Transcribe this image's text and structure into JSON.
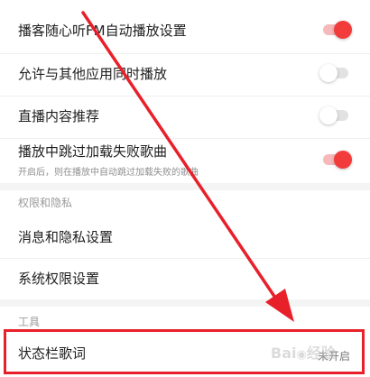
{
  "playback": {
    "items": [
      {
        "label": "播客随心听FM自动播放设置",
        "state": "on"
      },
      {
        "label": "允许与其他应用同时播放",
        "state": "off"
      },
      {
        "label": "直播内容推荐",
        "state": "off"
      },
      {
        "label": "播放中跳过加载失败歌曲",
        "sub": "开启后，则在播放中自动跳过加载失败的歌曲",
        "state": "on"
      }
    ]
  },
  "privacy": {
    "title": "权限和隐私",
    "items": [
      {
        "label": "消息和隐私设置"
      },
      {
        "label": "系统权限设置"
      }
    ]
  },
  "tools": {
    "title": "工具",
    "items": [
      {
        "label": "状态栏歌词",
        "value": "未开启"
      }
    ]
  },
  "colors": {
    "accent_red": "#f23c3c",
    "highlight_border": "#e8202a",
    "annotation_arrow": "#e8202a"
  }
}
